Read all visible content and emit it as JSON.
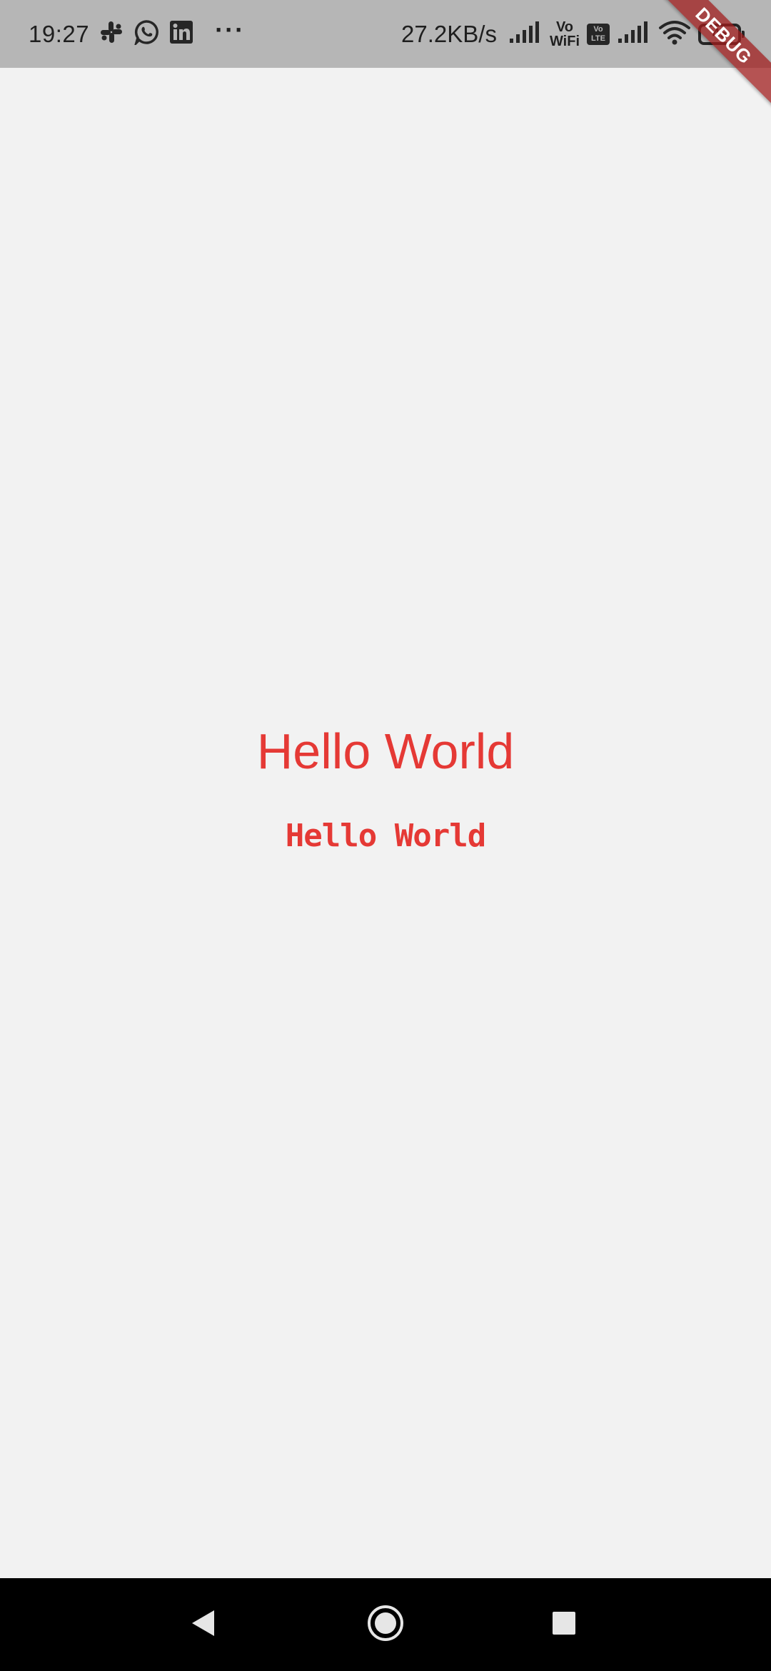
{
  "status_bar": {
    "time": "19:27",
    "more": "···",
    "network_speed": "27.2KB/s",
    "vo_wifi_top": "Vo",
    "vo_wifi_bottom": "WiFi",
    "volte_top": "Vo",
    "volte_bottom": "LTE",
    "battery_level": "45",
    "notification_icons": [
      "slack-icon",
      "whatsapp-icon",
      "linkedin-icon"
    ],
    "system_icons": [
      "signal-icon",
      "vowifi-icon",
      "volte-icon",
      "signal-icon",
      "wifi-icon",
      "battery-icon"
    ]
  },
  "debug_banner": {
    "label": "DEBUG"
  },
  "main": {
    "title_regular": "Hello World",
    "title_pixel": "Hello World"
  },
  "navigation": {
    "buttons": [
      "back-icon",
      "home-icon",
      "recents-icon"
    ]
  },
  "colors": {
    "background": "#f2f2f2",
    "status_bar": "#b6b6b6",
    "text_accent": "#e53935",
    "nav_bar": "#000000",
    "debug_ribbon": "#a01e1e"
  }
}
